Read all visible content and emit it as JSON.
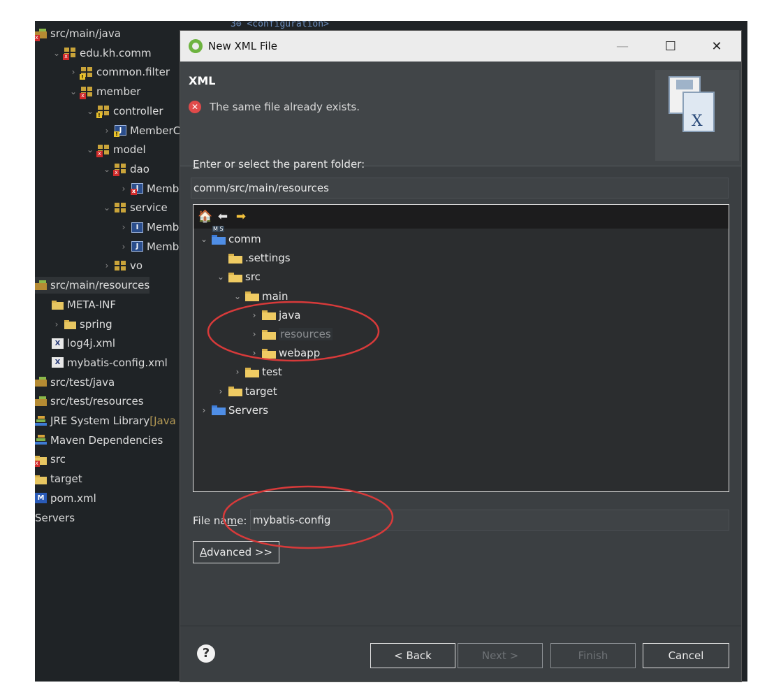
{
  "ide": {
    "code_peek": "3⊖ <configuration>",
    "explorer": [
      {
        "indent": 0,
        "chev": "",
        "icon": "src-folder-error",
        "label": "src/main/java"
      },
      {
        "indent": 1,
        "chev": "⌄",
        "icon": "package-error",
        "label": "edu.kh.comm"
      },
      {
        "indent": 2,
        "chev": "›",
        "icon": "package-warning",
        "label": "common.filter"
      },
      {
        "indent": 2,
        "chev": "⌄",
        "icon": "package-error",
        "label": "member"
      },
      {
        "indent": 3,
        "chev": "⌄",
        "icon": "package-warning",
        "label": "controller"
      },
      {
        "indent": 4,
        "chev": "›",
        "icon": "java-warning",
        "label": "MemberCo"
      },
      {
        "indent": 3,
        "chev": "⌄",
        "icon": "package-error",
        "label": "model"
      },
      {
        "indent": 4,
        "chev": "⌄",
        "icon": "package-error",
        "label": "dao"
      },
      {
        "indent": 5,
        "chev": "›",
        "icon": "java-error",
        "label": "Member"
      },
      {
        "indent": 4,
        "chev": "⌄",
        "icon": "package",
        "label": "service"
      },
      {
        "indent": 5,
        "chev": "›",
        "icon": "interface",
        "label": "Member"
      },
      {
        "indent": 5,
        "chev": "›",
        "icon": "java",
        "label": "Member"
      },
      {
        "indent": 4,
        "chev": "›",
        "icon": "package",
        "label": "vo"
      },
      {
        "indent": 0,
        "chev": "",
        "icon": "src-folder",
        "label": "src/main/resources",
        "selected": true
      },
      {
        "indent": 1,
        "chev": "",
        "icon": "folder",
        "label": "META-INF"
      },
      {
        "indent": 1,
        "chev": "›",
        "icon": "folder",
        "label": "spring"
      },
      {
        "indent": 1,
        "chev": "",
        "icon": "xml-file",
        "label": "log4j.xml"
      },
      {
        "indent": 1,
        "chev": "",
        "icon": "xml-file",
        "label": "mybatis-config.xml"
      },
      {
        "indent": 0,
        "chev": "",
        "icon": "src-folder",
        "label": "src/test/java"
      },
      {
        "indent": 0,
        "chev": "",
        "icon": "src-folder",
        "label": "src/test/resources"
      },
      {
        "indent": 0,
        "chev": "",
        "icon": "library",
        "label": "JRE System Library",
        "suffix": " [Java"
      },
      {
        "indent": 0,
        "chev": "",
        "icon": "library",
        "label": "Maven Dependencies"
      },
      {
        "indent": 0,
        "chev": "",
        "icon": "folder-error",
        "label": "src"
      },
      {
        "indent": 0,
        "chev": "",
        "icon": "folder",
        "label": "target"
      },
      {
        "indent": 0,
        "chev": "",
        "icon": "maven-file",
        "label": "pom.xml"
      },
      {
        "indent": 0,
        "chev": "",
        "icon": "none",
        "label": "Servers"
      }
    ]
  },
  "dialog": {
    "title": "New XML File",
    "minimize": "—",
    "maximize": "☐",
    "close": "✕",
    "header_title": "XML",
    "header_message": "The same file already exists.",
    "error_icon": "✕",
    "parent_label": "Enter or select the parent folder:",
    "parent_value": "comm/src/main/resources",
    "tree_toolbar": {
      "home": "🏠",
      "back": "⬅",
      "forward": "➡"
    },
    "tree": [
      {
        "level": 0,
        "chev": "⌄",
        "type": "project",
        "label": "comm"
      },
      {
        "level": 1,
        "chev": "",
        "type": "folder",
        "label": ".settings"
      },
      {
        "level": 1,
        "chev": "⌄",
        "type": "folder",
        "label": "src"
      },
      {
        "level": 2,
        "chev": "⌄",
        "type": "folder",
        "label": "main"
      },
      {
        "level": 3,
        "chev": "›",
        "type": "folder",
        "label": "java"
      },
      {
        "level": 3,
        "chev": "›",
        "type": "folder",
        "label": "resources",
        "selected": true
      },
      {
        "level": 3,
        "chev": "›",
        "type": "folder",
        "label": "webapp"
      },
      {
        "level": 2,
        "chev": "›",
        "type": "folder",
        "label": "test"
      },
      {
        "level": 1,
        "chev": "›",
        "type": "folder",
        "label": "target"
      },
      {
        "level": 0,
        "chev": "›",
        "type": "servers",
        "label": "Servers"
      }
    ],
    "file_name_label": "File name:",
    "file_name_value": "mybatis-config",
    "advanced_label": "Advanced >>",
    "help": "?",
    "buttons": {
      "back": "< Back",
      "next": "Next >",
      "finish": "Finish",
      "cancel": "Cancel"
    }
  },
  "colors": {
    "annotation": "#d83a3a",
    "accent": "#6db33f"
  }
}
